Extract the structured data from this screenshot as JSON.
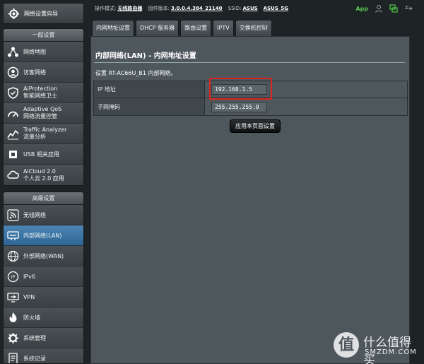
{
  "sidebar": {
    "qis_label": "网络设置向导",
    "general": {
      "header": "一般设置",
      "items": [
        {
          "label": "网络地图",
          "icon": "network-map-icon"
        },
        {
          "label": "访客网络",
          "icon": "guest-network-icon"
        },
        {
          "label": "AiProtection",
          "sub": "智能网络卫士",
          "icon": "shield-icon"
        },
        {
          "label": "Adaptive QoS",
          "sub": "网络流量控管",
          "icon": "gauge-icon"
        },
        {
          "label": "Traffic Analyzer",
          "sub": "流量分析",
          "icon": "traffic-chart-icon"
        },
        {
          "label": "USB 相关应用",
          "icon": "usb-puzzle-icon"
        },
        {
          "label": "AiCloud 2.0",
          "sub": "个人云 2.0 应用",
          "icon": "cloud-icon"
        }
      ]
    },
    "advanced": {
      "header": "高级设置",
      "items": [
        {
          "label": "无线网络",
          "icon": "wifi-icon"
        },
        {
          "label": "内部网络(LAN)",
          "icon": "lan-icon",
          "active": true
        },
        {
          "label": "外部网络(WAN)",
          "icon": "globe-icon"
        },
        {
          "label": "IPv6",
          "icon": "ipv6-icon"
        },
        {
          "label": "VPN",
          "icon": "vpn-icon"
        },
        {
          "label": "防火墙",
          "icon": "firewall-icon"
        },
        {
          "label": "系统管理",
          "icon": "settings-icon"
        },
        {
          "label": "系统记录",
          "icon": "log-icon"
        }
      ]
    }
  },
  "topbar": {
    "mode_label": "操作模式:",
    "mode_value": "无线路由器",
    "firmware_label": "固件版本:",
    "firmware_value": "3.0.0.4.384_21140",
    "ssid_label": "SSID:",
    "ssid_1": "ASUS",
    "ssid_2": "ASUS_5G",
    "app_label": "App"
  },
  "tabs": [
    {
      "label": "内网地址设置",
      "active": true
    },
    {
      "label": "DHCP 服务器"
    },
    {
      "label": "路由设置"
    },
    {
      "label": "IPTV"
    },
    {
      "label": "交换机控制"
    }
  ],
  "main": {
    "title": "内部网络(LAN) - 内网地址设置",
    "description": "设置 RT-AC66U_B1 内部网络。",
    "ip_label": "IP 地址",
    "ip_value": "192.168.1.5",
    "mask_label": "子网掩码",
    "mask_value": "255.255.255.0",
    "apply_label": "应用本页面设置"
  },
  "watermark": {
    "glyph": "值",
    "line1": "什么值得买",
    "line2": "SMZDM.COM"
  },
  "colors": {
    "active_item": "#3a77a8",
    "highlight_box": "#e0241d",
    "app_green": "#54c54c"
  }
}
